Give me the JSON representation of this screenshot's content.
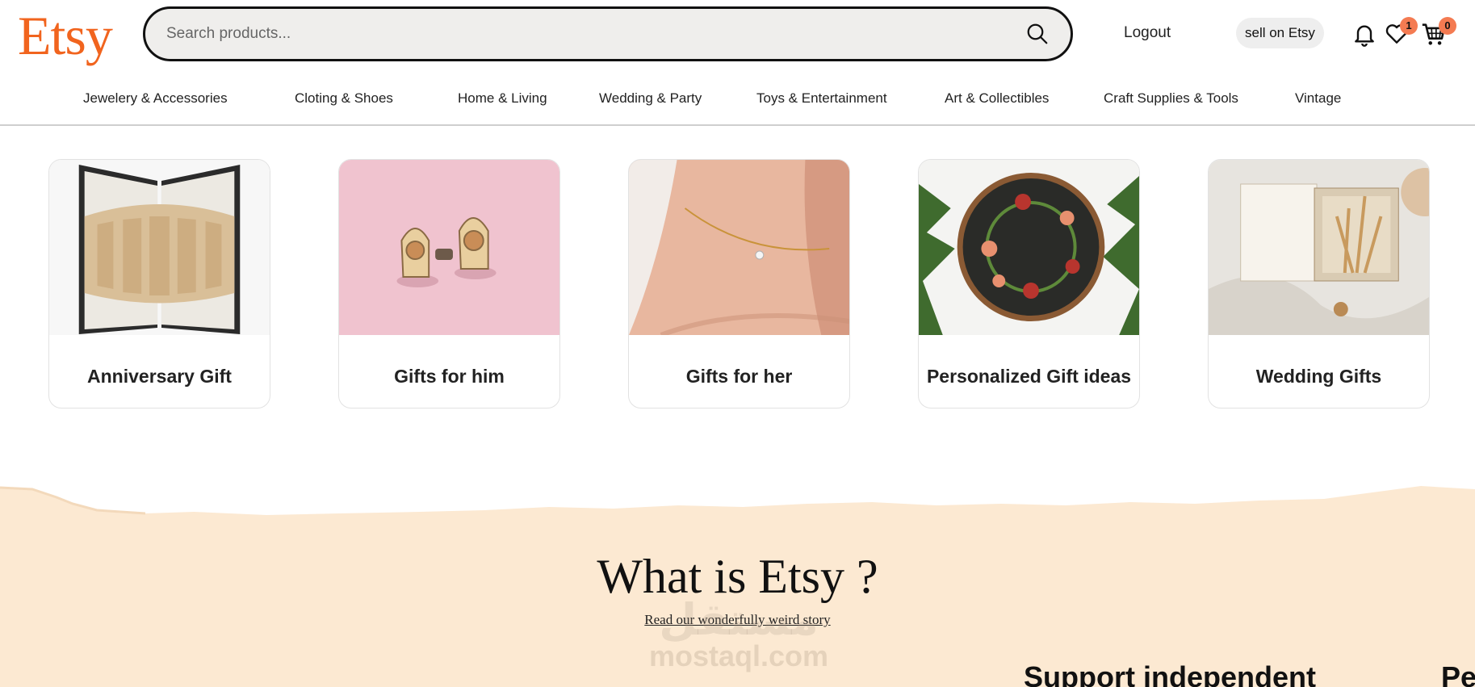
{
  "header": {
    "logo": "Etsy",
    "search_placeholder": "Search products...",
    "logout_label": "Logout",
    "sell_label": "sell on Etsy",
    "favorites_count": "1",
    "cart_count": "0",
    "icons": [
      "search-icon",
      "bell-icon",
      "heart-icon",
      "cart-icon"
    ]
  },
  "nav": {
    "items": [
      "Jewelery & Accessories",
      "Cloting & Shoes",
      "Home & Living",
      "Wedding & Party",
      "Toys & Entertainment",
      "Art & Collectibles",
      "Craft Supplies & Tools",
      "Vintage"
    ]
  },
  "gifts": {
    "cards": [
      {
        "title": "Anniversary Gift"
      },
      {
        "title": "Gifts for him"
      },
      {
        "title": "Gifts for her"
      },
      {
        "title": "Personalized Gift ideas"
      },
      {
        "title": "Wedding Gifts"
      }
    ]
  },
  "about": {
    "title": "What is Etsy ?",
    "link": "Read our wonderfully weird story",
    "support_heading": "Support independent",
    "next_heading_partial": "Pe",
    "watermark_ar": "مستقل",
    "watermark": "mostaql.com"
  },
  "colors": {
    "brand": "#f1641e",
    "badge": "#f47b52",
    "section_bg": "#fce9d2",
    "search_bg": "#efeeec"
  }
}
